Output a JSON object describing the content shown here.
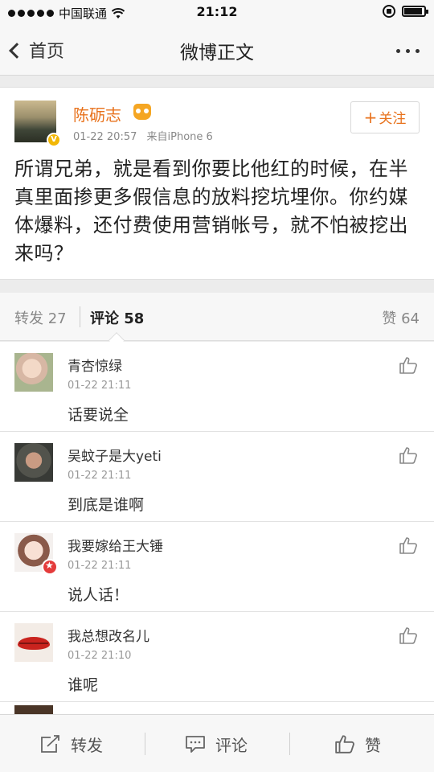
{
  "status_bar": {
    "carrier": "中国联通",
    "time": "21:12"
  },
  "nav": {
    "back_label": "首页",
    "title": "微博正文"
  },
  "post": {
    "author": "陈砺志",
    "time": "01-22 20:57",
    "source": "来自iPhone 6",
    "follow_label": "关注",
    "text": "所谓兄弟，就是看到你要比他红的时候，在半真里面掺更多假信息的放料挖坑埋你。你约媒体爆料，还付费使用营销帐号，就不怕被挖出来吗？"
  },
  "tabs": {
    "repost": "转发 27",
    "comment": "评论 58",
    "like": "赞 64"
  },
  "comments": [
    {
      "name": "青杏惊绿",
      "time": "01-22 21:11",
      "text": "话要说全"
    },
    {
      "name": "吴蚊子是大yeti",
      "time": "01-22 21:11",
      "text": "到底是谁啊"
    },
    {
      "name": "我要嫁给王大锤",
      "time": "01-22 21:11",
      "text": "说人话！"
    },
    {
      "name": "我总想改名儿",
      "time": "01-22 21:10",
      "text": "谁呢"
    }
  ],
  "toolbar": {
    "repost": "转发",
    "comment": "评论",
    "like": "赞"
  },
  "colors": {
    "accent": "#e8721c",
    "background": "#ececec"
  }
}
